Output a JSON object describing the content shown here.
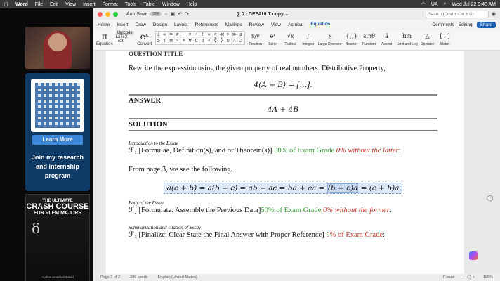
{
  "menubar": {
    "apple": "",
    "app": "Word",
    "items": [
      "File",
      "Edit",
      "View",
      "Insert",
      "Format",
      "Tools",
      "Table",
      "Window",
      "Help"
    ],
    "right": {
      "lang": "UA",
      "datetime": "Wed Jul 22  9:48 AM"
    }
  },
  "sidebar": {
    "learn_more": "Learn More",
    "promo_text": "Join my research and internship program",
    "book": {
      "line1": "THE ULTIMATE",
      "line2": "CRASH COURSE",
      "line3": "FOR PLEM MAJORS",
      "author": "Author Jonathan David"
    }
  },
  "word": {
    "autosave": "AutoSave",
    "autosave_state": "OFF",
    "doc_title": "  ∑ 0 - DEFAULT copy ⌄",
    "search_placeholder": "Search (Cmd + Ctrl + U)",
    "tabs": [
      "Home",
      "Insert",
      "Draw",
      "Design",
      "Layout",
      "References",
      "Mailings",
      "Review",
      "View",
      "Acrobat",
      "Equation"
    ],
    "active_tab": "Equation",
    "comments": "Comments",
    "editing": "Editing",
    "share": "Share",
    "ribbon": {
      "equation": "Equation",
      "unicode": "Unicode",
      "latex": "LaTeX",
      "text": "Text",
      "convert": "Convert",
      "symbols": [
        "±",
        "∞",
        "=",
        "≠",
        "~",
        "×",
        "÷",
        "!",
        "∝",
        "<",
        "≪",
        ">",
        "≫",
        "≤",
        "≥",
        "∓",
        "≅",
        "≈",
        "≡",
        "∀",
        "∁",
        "∂",
        "√",
        "∛",
        "∜",
        "∪",
        "∩",
        "∅"
      ],
      "structures": [
        "Fraction",
        "Script",
        "Radical",
        "Integral",
        "Large Operator",
        "Bracket",
        "Function",
        "Accent",
        "Limit and Log",
        "Operator",
        "Matrix"
      ],
      "structure_icons": [
        "x/y",
        "eˣ",
        "√x",
        "∫",
        "∑",
        "{()}",
        "sinθ",
        "ä",
        "lim",
        "△",
        "[⋮]"
      ]
    },
    "doc": {
      "question_title": "QUESTION TITLE",
      "prompt": "Rewrite the expression using the given property of real numbers. Distributive Property,",
      "expression": "4(A + B) = […].",
      "answer_heading": "ANSWER",
      "answer": "4A + 4B",
      "solution_heading": "SOLUTION",
      "intro_label": "Introduction to the Essay",
      "f1_text": "ℱ₁ [Formulae, Definition(s), and or Theorem(s)] ",
      "f1_grade": "50% of Exam Grade",
      "f1_warning": " 0% without the latter",
      "f1_end": ":",
      "page_ref": "From page 3, we see the following.",
      "eq_part1": "a(c + b) = a(b + c) = ab + ac = ba + ca = ",
      "eq_hl": "(b + c)a",
      "eq_part2": " = (c + b)a",
      "body_label": "Body of the Essay",
      "f2_text": "ℱ₂ [Formulate: Assemble the Previous Data]",
      "f2_grade": "50% of Exam Grade",
      "f2_warning": " 0% without the former",
      "f2_end": ":",
      "summary_label": "Summarization and citation of Essay",
      "f3_text": "ℱ₃ [Finalize: Clear State the Final Answer with Proper Reference] ",
      "f3_grade": "0% of Exam Grade",
      "f3_end": ":"
    },
    "status": {
      "page": "Page 2 of 2",
      "words": "289 words",
      "language": "English (United States)",
      "focus": "Focus",
      "zoom": "185%"
    }
  }
}
